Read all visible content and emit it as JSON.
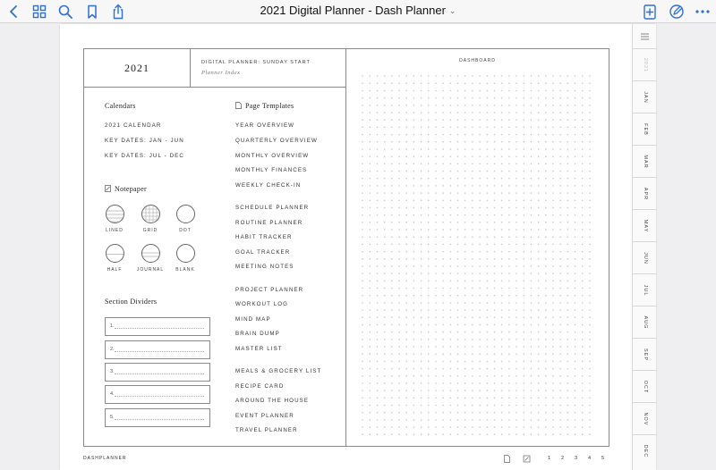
{
  "app": {
    "title": "2021 Digital Planner - Dash Planner",
    "title_chevron": "⌄"
  },
  "planner": {
    "year": "2021",
    "header_kicker": "DIGITAL PLANNER: SUNDAY START",
    "header_sub": "Planner Index",
    "calendars": {
      "title": "Calendars",
      "items": [
        "2021 CALENDAR",
        "KEY DATES: JAN - JUN",
        "KEY DATES: JUL - DEC"
      ]
    },
    "notepaper": {
      "title": "Notepaper",
      "items": [
        "LINED",
        "GRID",
        "DOT",
        "HALF",
        "JOURNAL",
        "BLANK"
      ]
    },
    "section_dividers": {
      "title": "Section Dividers",
      "items": [
        "1.",
        "2.",
        "3.",
        "4.",
        "5."
      ]
    },
    "page_templates": {
      "title": "Page Templates",
      "group1": [
        "YEAR OVERVIEW",
        "QUARTERLY OVERVIEW",
        "MONTHLY OVERVIEW",
        "MONTHLY FINANCES",
        "WEEKLY CHECK-IN"
      ],
      "group2": [
        "SCHEDULE PLANNER",
        "ROUTINE PLANNER",
        "HABIT TRACKER",
        "GOAL TRACKER",
        "MEETING NOTES"
      ],
      "group3": [
        "PROJECT PLANNER",
        "WORKOUT LOG",
        "MIND MAP",
        "BRAIN DUMP",
        "MASTER LIST"
      ],
      "group4": [
        "MEALS & GROCERY LIST",
        "RECIPE CARD",
        "AROUND THE HOUSE",
        "EVENT PLANNER",
        "TRAVEL PLANNER"
      ]
    },
    "dashboard_title": "DASHBOARD",
    "footer_brand": "DASHPLANNER",
    "footer_pages": [
      "1",
      "2",
      "3",
      "4",
      "5"
    ]
  },
  "tabs": [
    "2021",
    "JAN",
    "FEB",
    "MAR",
    "APR",
    "MAY",
    "JUN",
    "JUL",
    "AUG",
    "SEP",
    "OCT",
    "NOV",
    "DEC"
  ],
  "colors": {
    "accent": "#2f6fd6",
    "frame": "#8a8a8a",
    "page_bg": "#ffffff",
    "app_bg": "#efeff1"
  },
  "icons": {
    "back": "chevron-left-icon",
    "thumbnails": "grid-icon",
    "search": "search-icon",
    "bookmark": "bookmark-icon",
    "share": "share-icon",
    "add_page": "add-page-icon",
    "markup": "pencil-circle-icon",
    "more": "more-icon"
  }
}
